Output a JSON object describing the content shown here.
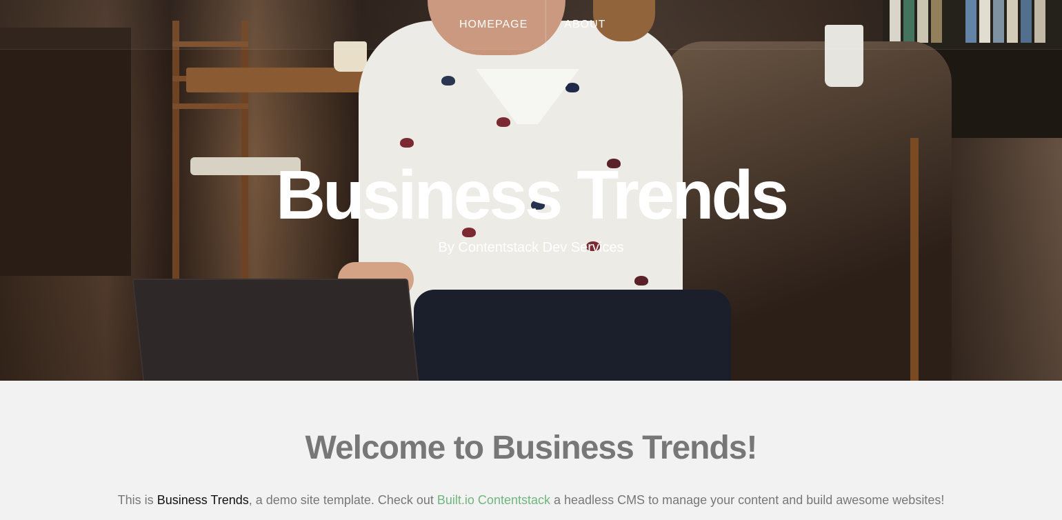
{
  "nav": {
    "items": [
      {
        "label": "HOMEPAGE"
      },
      {
        "label": "ABOUT"
      }
    ]
  },
  "hero": {
    "title": "Business Trends",
    "subtitle": "By Contentstack Dev Services"
  },
  "content": {
    "heading": "Welcome to Business Trends!",
    "intro": {
      "prefix": "This is ",
      "brand": "Business Trends",
      "middle": ", a demo site template. Check out ",
      "link_text": "Built.io Contentstack",
      "suffix": " a headless CMS to manage your content and build awesome websites!"
    }
  },
  "colors": {
    "page_background": "#f2f2f2",
    "text_muted": "#777777",
    "link": "#6fb67e"
  }
}
